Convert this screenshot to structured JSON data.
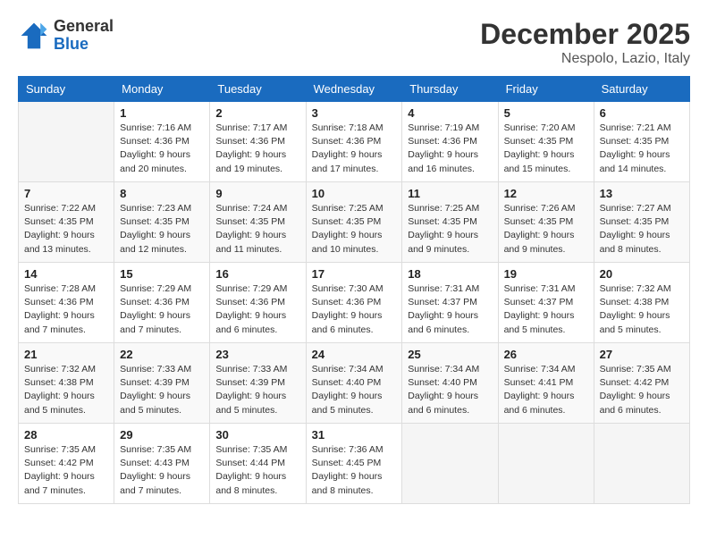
{
  "header": {
    "logo_line1": "General",
    "logo_line2": "Blue",
    "month": "December 2025",
    "location": "Nespolo, Lazio, Italy"
  },
  "days_of_week": [
    "Sunday",
    "Monday",
    "Tuesday",
    "Wednesday",
    "Thursday",
    "Friday",
    "Saturday"
  ],
  "weeks": [
    [
      {
        "day": "",
        "info": ""
      },
      {
        "day": "1",
        "info": "Sunrise: 7:16 AM\nSunset: 4:36 PM\nDaylight: 9 hours\nand 20 minutes."
      },
      {
        "day": "2",
        "info": "Sunrise: 7:17 AM\nSunset: 4:36 PM\nDaylight: 9 hours\nand 19 minutes."
      },
      {
        "day": "3",
        "info": "Sunrise: 7:18 AM\nSunset: 4:36 PM\nDaylight: 9 hours\nand 17 minutes."
      },
      {
        "day": "4",
        "info": "Sunrise: 7:19 AM\nSunset: 4:36 PM\nDaylight: 9 hours\nand 16 minutes."
      },
      {
        "day": "5",
        "info": "Sunrise: 7:20 AM\nSunset: 4:35 PM\nDaylight: 9 hours\nand 15 minutes."
      },
      {
        "day": "6",
        "info": "Sunrise: 7:21 AM\nSunset: 4:35 PM\nDaylight: 9 hours\nand 14 minutes."
      }
    ],
    [
      {
        "day": "7",
        "info": "Sunrise: 7:22 AM\nSunset: 4:35 PM\nDaylight: 9 hours\nand 13 minutes."
      },
      {
        "day": "8",
        "info": "Sunrise: 7:23 AM\nSunset: 4:35 PM\nDaylight: 9 hours\nand 12 minutes."
      },
      {
        "day": "9",
        "info": "Sunrise: 7:24 AM\nSunset: 4:35 PM\nDaylight: 9 hours\nand 11 minutes."
      },
      {
        "day": "10",
        "info": "Sunrise: 7:25 AM\nSunset: 4:35 PM\nDaylight: 9 hours\nand 10 minutes."
      },
      {
        "day": "11",
        "info": "Sunrise: 7:25 AM\nSunset: 4:35 PM\nDaylight: 9 hours\nand 9 minutes."
      },
      {
        "day": "12",
        "info": "Sunrise: 7:26 AM\nSunset: 4:35 PM\nDaylight: 9 hours\nand 9 minutes."
      },
      {
        "day": "13",
        "info": "Sunrise: 7:27 AM\nSunset: 4:35 PM\nDaylight: 9 hours\nand 8 minutes."
      }
    ],
    [
      {
        "day": "14",
        "info": "Sunrise: 7:28 AM\nSunset: 4:36 PM\nDaylight: 9 hours\nand 7 minutes."
      },
      {
        "day": "15",
        "info": "Sunrise: 7:29 AM\nSunset: 4:36 PM\nDaylight: 9 hours\nand 7 minutes."
      },
      {
        "day": "16",
        "info": "Sunrise: 7:29 AM\nSunset: 4:36 PM\nDaylight: 9 hours\nand 6 minutes."
      },
      {
        "day": "17",
        "info": "Sunrise: 7:30 AM\nSunset: 4:36 PM\nDaylight: 9 hours\nand 6 minutes."
      },
      {
        "day": "18",
        "info": "Sunrise: 7:31 AM\nSunset: 4:37 PM\nDaylight: 9 hours\nand 6 minutes."
      },
      {
        "day": "19",
        "info": "Sunrise: 7:31 AM\nSunset: 4:37 PM\nDaylight: 9 hours\nand 5 minutes."
      },
      {
        "day": "20",
        "info": "Sunrise: 7:32 AM\nSunset: 4:38 PM\nDaylight: 9 hours\nand 5 minutes."
      }
    ],
    [
      {
        "day": "21",
        "info": "Sunrise: 7:32 AM\nSunset: 4:38 PM\nDaylight: 9 hours\nand 5 minutes."
      },
      {
        "day": "22",
        "info": "Sunrise: 7:33 AM\nSunset: 4:39 PM\nDaylight: 9 hours\nand 5 minutes."
      },
      {
        "day": "23",
        "info": "Sunrise: 7:33 AM\nSunset: 4:39 PM\nDaylight: 9 hours\nand 5 minutes."
      },
      {
        "day": "24",
        "info": "Sunrise: 7:34 AM\nSunset: 4:40 PM\nDaylight: 9 hours\nand 5 minutes."
      },
      {
        "day": "25",
        "info": "Sunrise: 7:34 AM\nSunset: 4:40 PM\nDaylight: 9 hours\nand 6 minutes."
      },
      {
        "day": "26",
        "info": "Sunrise: 7:34 AM\nSunset: 4:41 PM\nDaylight: 9 hours\nand 6 minutes."
      },
      {
        "day": "27",
        "info": "Sunrise: 7:35 AM\nSunset: 4:42 PM\nDaylight: 9 hours\nand 6 minutes."
      }
    ],
    [
      {
        "day": "28",
        "info": "Sunrise: 7:35 AM\nSunset: 4:42 PM\nDaylight: 9 hours\nand 7 minutes."
      },
      {
        "day": "29",
        "info": "Sunrise: 7:35 AM\nSunset: 4:43 PM\nDaylight: 9 hours\nand 7 minutes."
      },
      {
        "day": "30",
        "info": "Sunrise: 7:35 AM\nSunset: 4:44 PM\nDaylight: 9 hours\nand 8 minutes."
      },
      {
        "day": "31",
        "info": "Sunrise: 7:36 AM\nSunset: 4:45 PM\nDaylight: 9 hours\nand 8 minutes."
      },
      {
        "day": "",
        "info": ""
      },
      {
        "day": "",
        "info": ""
      },
      {
        "day": "",
        "info": ""
      }
    ]
  ]
}
